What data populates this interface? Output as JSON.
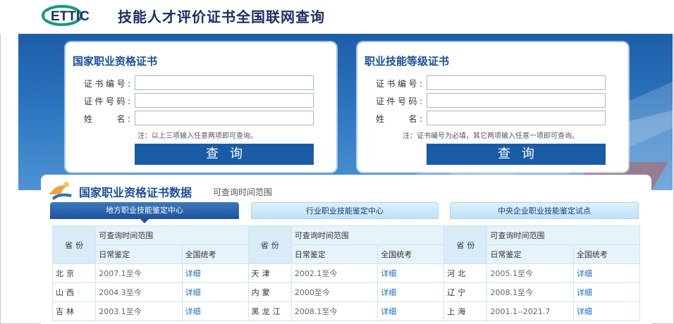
{
  "header": {
    "logo_text": "ETTIC",
    "title": "技能人才评价证书全国联网查询"
  },
  "panels": [
    {
      "title": "国家职业资格证书",
      "fields": [
        {
          "label": "证书编号:",
          "value": ""
        },
        {
          "label": "证件号码:",
          "value": ""
        },
        {
          "label": "姓　　名:",
          "value": ""
        }
      ],
      "hint": "注：以上三项输入任意两项即可查询。",
      "button": "查询"
    },
    {
      "title": "职业技能等级证书",
      "fields": [
        {
          "label": "证书编号:",
          "value": ""
        },
        {
          "label": "证件号码:",
          "value": ""
        },
        {
          "label": "姓　　名:",
          "value": ""
        }
      ],
      "hint": "注：证书编号为必填，其它两项输入任意一项即可查询。",
      "button": "查询"
    }
  ],
  "data_section": {
    "title": "国家职业资格证书数据",
    "subtitle": "可查询时间范围",
    "tabs": [
      "地方职业技能鉴定中心",
      "行业职业技能鉴定中心",
      "中央企业职业技能鉴定试点"
    ],
    "active_tab": 0
  },
  "table": {
    "province_header": "省份",
    "range_header": "可查询时间范围",
    "daily_header": "日常鉴定",
    "national_header": "全国统考",
    "rows": [
      [
        {
          "province": "北京",
          "daily": "2007.1至今",
          "national": "详细"
        },
        {
          "province": "天津",
          "daily": "2002.1至今",
          "national": "详细"
        },
        {
          "province": "河北",
          "daily": "2005.1至今",
          "national": "详细"
        }
      ],
      [
        {
          "province": "山西",
          "daily": "2004.3至今",
          "national": "详细"
        },
        {
          "province": "内蒙",
          "daily": "2000至今",
          "national": "详细"
        },
        {
          "province": "辽宁",
          "daily": "2008.1至今",
          "national": "详细"
        }
      ],
      [
        {
          "province": "吉林",
          "daily": "2003.1至今",
          "national": "详细"
        },
        {
          "province": "黑龙江",
          "daily": "2008.1至今",
          "national": "详细"
        },
        {
          "province": "上海",
          "daily": "2001.1--2021.7",
          "national": "详细"
        }
      ]
    ]
  },
  "colors": {
    "primary": "#1a5ba6",
    "title_blue": "#1a4f9a",
    "link": "#1a6cc1",
    "logo_green": "#159a82"
  }
}
